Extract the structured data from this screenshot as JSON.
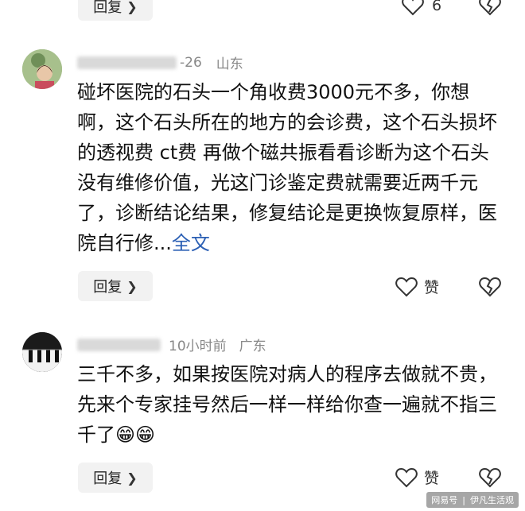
{
  "top_row": {
    "reply_label": "回复",
    "like_count": "6"
  },
  "comment1": {
    "time": "-26",
    "location": "山东",
    "text": "碰坏医院的石头一个角收费3000元不多，你想啊，这个石头所在的地方的会诊费，这个石头损坏的透视费 ct费 再做个磁共振看看诊断为这个石头没有维修价值，光这门诊鉴定费就需要近两千元了，诊断结论结果，修复结论是更换恢复原样，医院自行修...",
    "expand_label": "全文",
    "reply_label": "回复",
    "like_label": "赞"
  },
  "comment2": {
    "time": "10小时前",
    "location": "广东",
    "text": "三千不多，如果按医院对病人的程序去做就不贵，先来个专家挂号然后一样一样给你查一遍就不指三千了",
    "emoji": "😁😁",
    "reply_label": "回复",
    "like_label": "赞"
  },
  "watermark": {
    "left": "网易号",
    "right": "伊凡生活观"
  },
  "colors": {
    "link": "#2b5fb4",
    "meta_gray": "#888888",
    "button_bg": "#f2f2f2"
  }
}
